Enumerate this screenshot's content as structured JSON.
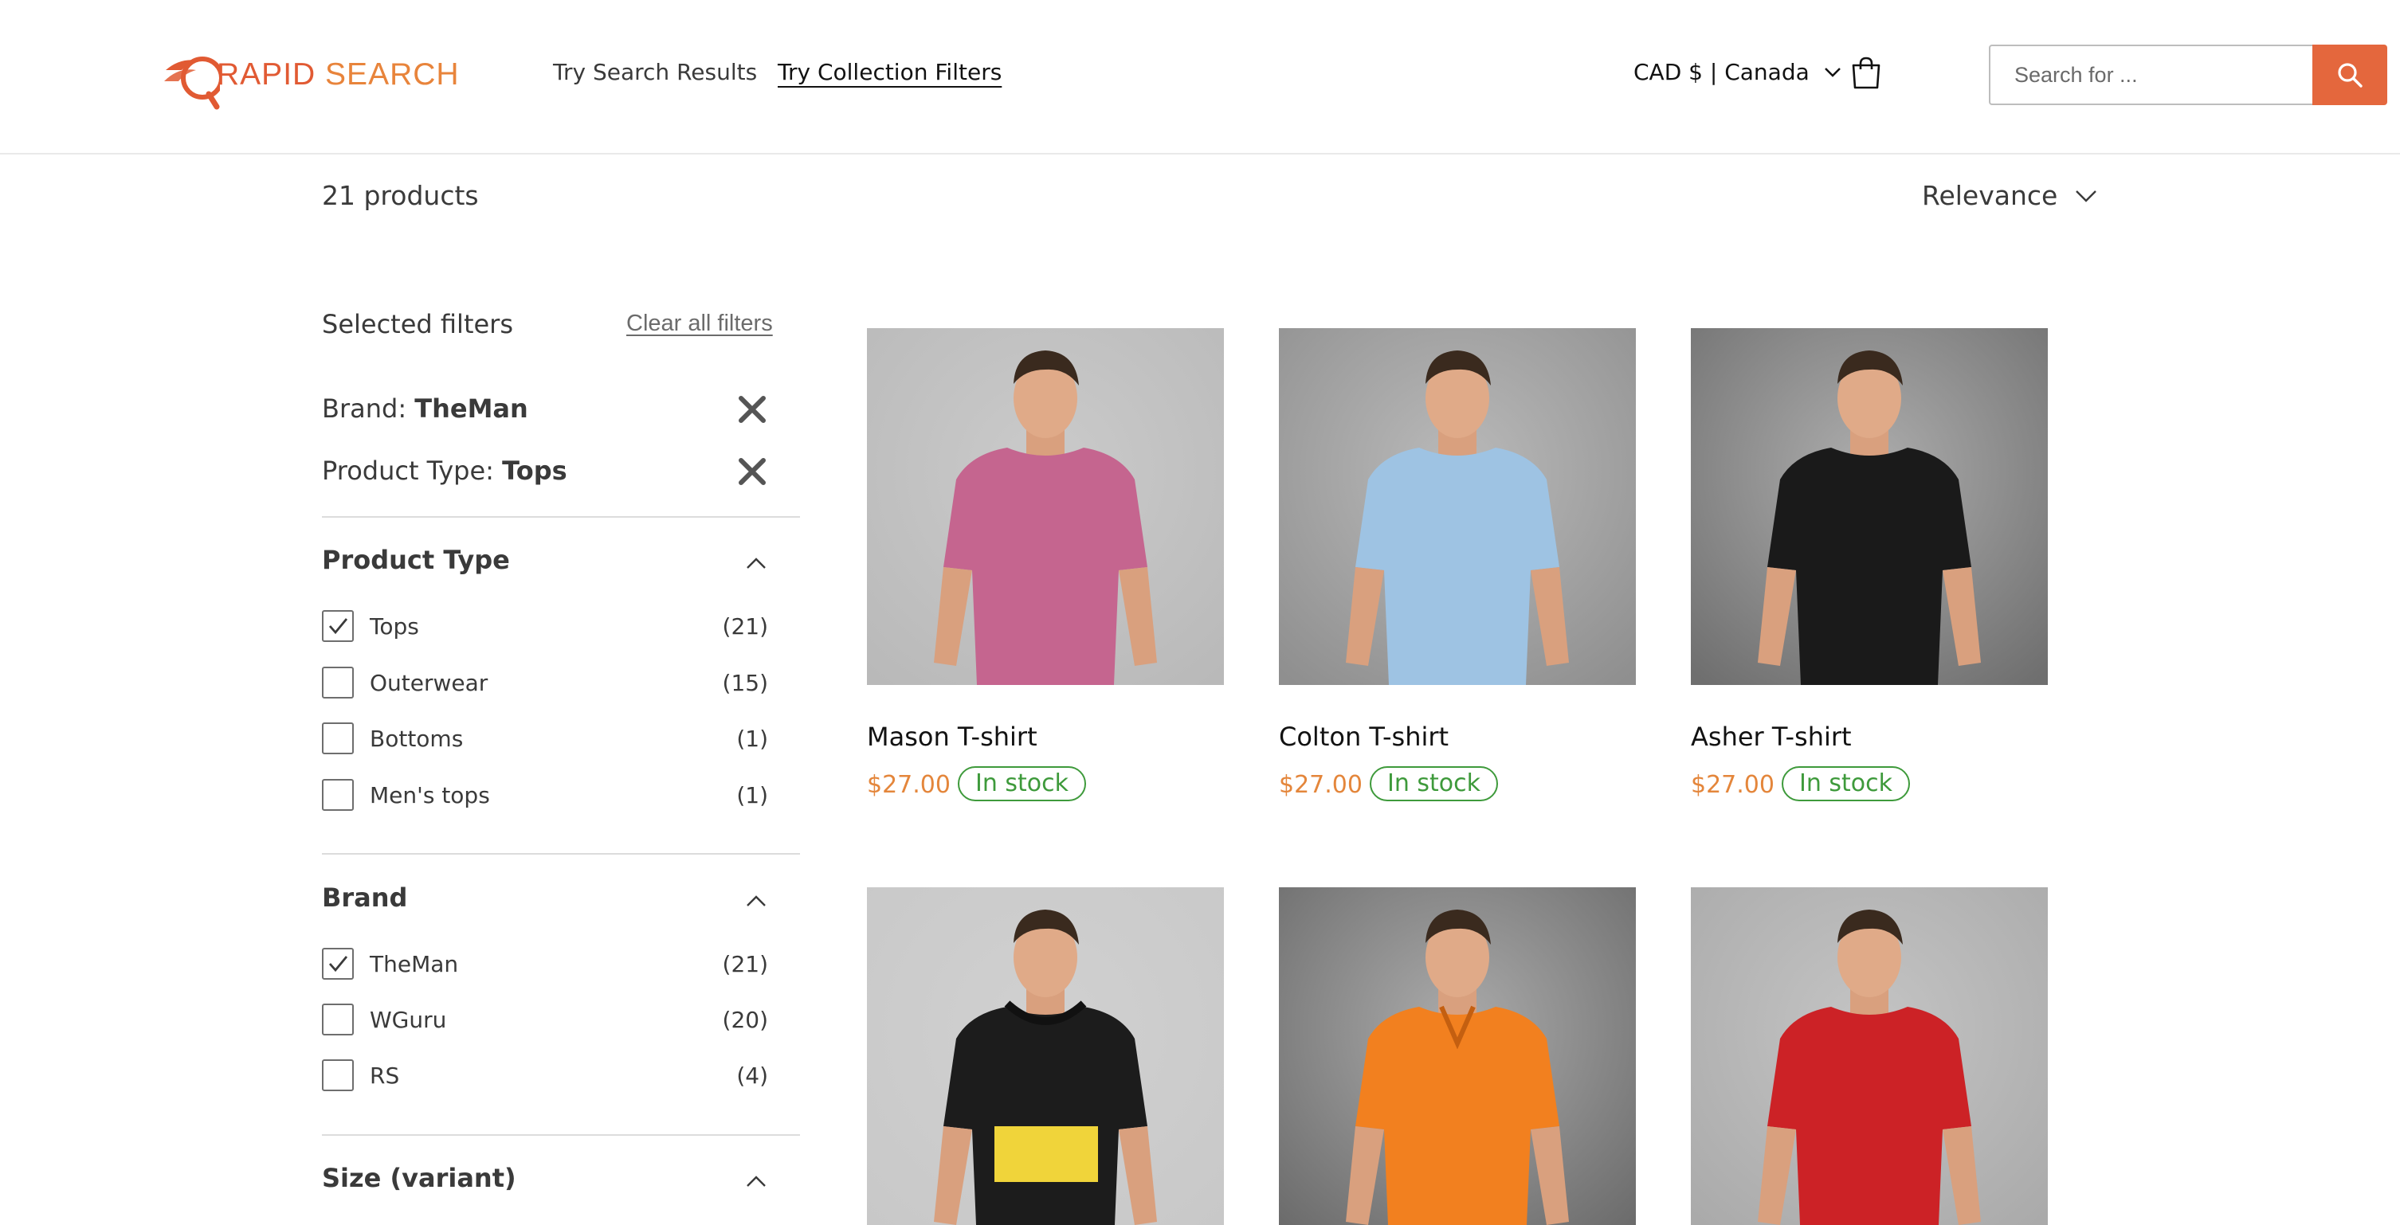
{
  "header": {
    "logo_text_first": "R",
    "logo_text_a": "APID ",
    "logo_text_b": "SEARCH",
    "nav": [
      {
        "label": "Try Search Results",
        "active": false
      },
      {
        "label": "Try Collection Filters",
        "active": true
      }
    ],
    "currency_label": "CAD $ | Canada",
    "search_placeholder": "Search for ...",
    "search_value": "",
    "accent_color": "#e4673d"
  },
  "toolbar": {
    "product_count": "21 products",
    "sort_label": "Relevance"
  },
  "sidebar": {
    "selected_title": "Selected filters",
    "clear_all": "Clear all filters",
    "chips": [
      {
        "key": "Brand:",
        "value": "TheMan"
      },
      {
        "key": "Product Type:",
        "value": "Tops"
      }
    ],
    "facets": [
      {
        "title": "Product Type",
        "expanded": true,
        "options": [
          {
            "label": "Tops",
            "count": "(21)",
            "checked": true
          },
          {
            "label": "Outerwear",
            "count": "(15)",
            "checked": false
          },
          {
            "label": "Bottoms",
            "count": "(1)",
            "checked": false
          },
          {
            "label": "Men's tops",
            "count": "(1)",
            "checked": false
          }
        ]
      },
      {
        "title": "Brand",
        "expanded": true,
        "options": [
          {
            "label": "TheMan",
            "count": "(21)",
            "checked": true
          },
          {
            "label": "WGuru",
            "count": "(20)",
            "checked": false
          },
          {
            "label": "RS",
            "count": "(4)",
            "checked": false
          }
        ]
      },
      {
        "title": "Size (variant)",
        "expanded": true,
        "options": []
      }
    ]
  },
  "products": [
    {
      "title": "Mason T-shirt",
      "price": "$27.00",
      "stock": "In stock",
      "shirt_color": "#c5658f",
      "bg_color": "#b9b9b9"
    },
    {
      "title": "Colton T-shirt",
      "price": "$27.00",
      "stock": "In stock",
      "shirt_color": "#9ec3e3",
      "bg_color": "#8f8f8f"
    },
    {
      "title": "Asher T-shirt",
      "price": "$27.00",
      "stock": "In stock",
      "shirt_color": "#1a1a1a",
      "bg_color": "#6f6f6f"
    },
    {
      "title": "",
      "price": "",
      "stock": "",
      "shirt_color": "#1c1c1c",
      "bg_color": "#c8c8c8"
    },
    {
      "title": "",
      "price": "",
      "stock": "",
      "shirt_color": "#f2801f",
      "bg_color": "#6a6a6a"
    },
    {
      "title": "",
      "price": "",
      "stock": "",
      "shirt_color": "#cc2226",
      "bg_color": "#a9a9a9"
    }
  ]
}
